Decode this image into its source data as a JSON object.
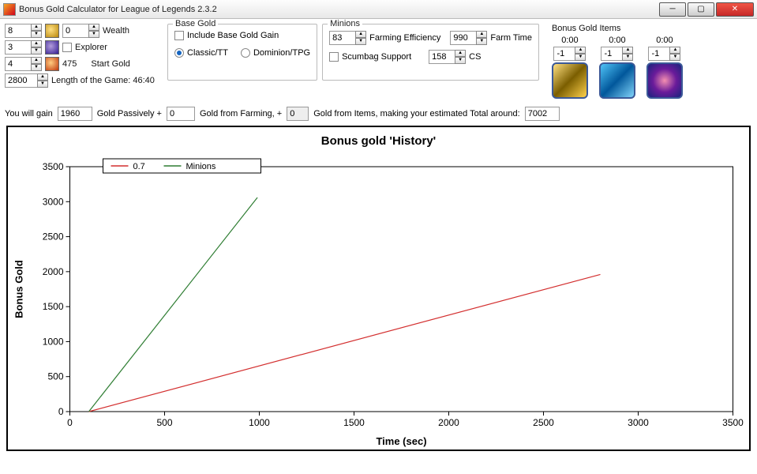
{
  "window": {
    "title": "Bonus Gold Calculator for League of Legends 2.3.2"
  },
  "left": {
    "sp1": "8",
    "sp2": "0",
    "wealth": "Wealth",
    "sp3": "3",
    "explorer": "Explorer",
    "sp4": "4",
    "startGoldVal": "475",
    "startGold": "Start Gold",
    "sp5": "2800",
    "lengthLabel": "Length of the Game: 46:40"
  },
  "baseGold": {
    "legend": "Base Gold",
    "include": "Include Base Gold Gain",
    "classic": "Classic/TT",
    "dominion": "Dominion/TPG"
  },
  "minions": {
    "legend": "Minions",
    "eff": "83",
    "effLabel": "Farming Efficiency",
    "farmTime": "990",
    "farmTimeLabel": "Farm Time",
    "scumbag": "Scumbag Support",
    "cs": "158",
    "csLabel": "CS"
  },
  "bonusItems": {
    "legend": "Bonus Gold Items",
    "t1": "0:00",
    "t2": "0:00",
    "t3": "0:00",
    "v1": "-1",
    "v2": "-1",
    "v3": "-1"
  },
  "summary": {
    "gain": "You will gain",
    "passively": "1960",
    "goldPassively": "Gold Passively +",
    "fromFarming": "0",
    "goldFarming": "Gold from Farming, +",
    "fromItems": "0",
    "itemsText": "Gold from Items, making your estimated Total around:",
    "total": "7002"
  },
  "chart_data": {
    "type": "line",
    "title": "Bonus gold 'History'",
    "xlabel": "Time (sec)",
    "ylabel": "Bonus Gold",
    "xlim": [
      0,
      3500
    ],
    "ylim": [
      0,
      3500
    ],
    "x_ticks": [
      0,
      500,
      1000,
      1500,
      2000,
      2500,
      3000,
      3500
    ],
    "y_ticks": [
      0,
      500,
      1000,
      1500,
      2000,
      2500,
      3000,
      3500
    ],
    "series": [
      {
        "name": "0.7",
        "color": "#d32f2f",
        "x": [
          100,
          2800
        ],
        "y": [
          0,
          1960
        ]
      },
      {
        "name": "Minions",
        "color": "#2e7d32",
        "x": [
          100,
          990
        ],
        "y": [
          0,
          3060
        ]
      }
    ]
  }
}
